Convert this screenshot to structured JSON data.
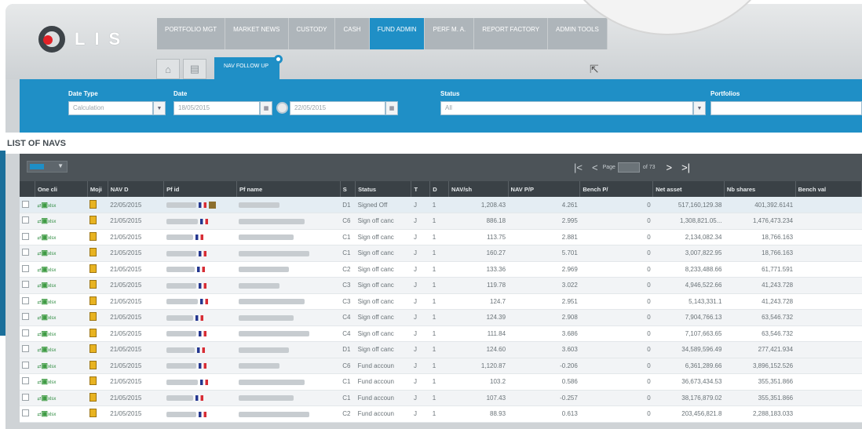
{
  "app": {
    "logo_text": "LIS"
  },
  "top_nav": {
    "tabs": [
      {
        "label": "PORTFOLIO MGT",
        "active": false
      },
      {
        "label": "MARKET NEWS",
        "active": false
      },
      {
        "label": "CUSTODY",
        "active": false
      },
      {
        "label": "CASH",
        "active": false
      },
      {
        "label": "FUND ADMIN",
        "active": true
      },
      {
        "label": "PERF M. A.",
        "active": false
      },
      {
        "label": "REPORT FACTORY",
        "active": false
      },
      {
        "label": "ADMIN TOOLS",
        "active": false
      }
    ]
  },
  "sub_nav": {
    "active_tab": "NAV FOLLOW UP"
  },
  "filters": {
    "date_type": {
      "label": "Date Type",
      "value": "Calculation"
    },
    "date": {
      "label": "Date",
      "from": "18/05/2015",
      "to": "22/05/2015"
    },
    "status": {
      "label": "Status",
      "value": "All"
    },
    "portfolios": {
      "label": "Portfolios",
      "value": ""
    }
  },
  "list": {
    "title": "LIST OF NAVS"
  },
  "pager": {
    "page_label": "Page",
    "page_value": "",
    "of_label": "of 73"
  },
  "columns": [
    "One cli",
    "Moji",
    "NAV D",
    "Pf id",
    "Pf name",
    "S",
    "Status",
    "T",
    "D",
    "NAV/sh",
    "NAV P/P",
    "Bench P/",
    "Net asset",
    "Nb shares",
    "Bench val"
  ],
  "rows": [
    {
      "date": "22/05/2015",
      "cls": "D1",
      "status": "Signed Off",
      "t": "J",
      "d": "1",
      "nav": "1,208.43",
      "navpp": "4.261",
      "bench": "0",
      "net": "517,160,129.38",
      "shares": "401,392.6141",
      "neg": false,
      "stamp": true
    },
    {
      "date": "21/05/2015",
      "cls": "C6",
      "status": "Sign off canc",
      "t": "J",
      "d": "1",
      "nav": "886.18",
      "navpp": "2.995",
      "bench": "0",
      "net": "1,308,821.05...",
      "shares": "1,476,473.234",
      "neg": false,
      "stamp": false
    },
    {
      "date": "21/05/2015",
      "cls": "C1",
      "status": "Sign off canc",
      "t": "J",
      "d": "1",
      "nav": "113.75",
      "navpp": "2.881",
      "bench": "0",
      "net": "2,134,082.34",
      "shares": "18,766.163",
      "neg": false,
      "stamp": false
    },
    {
      "date": "21/05/2015",
      "cls": "C1",
      "status": "Sign off canc",
      "t": "J",
      "d": "1",
      "nav": "160.27",
      "navpp": "5.701",
      "bench": "0",
      "net": "3,007,822.95",
      "shares": "18,766.163",
      "neg": false,
      "stamp": false
    },
    {
      "date": "21/05/2015",
      "cls": "C2",
      "status": "Sign off canc",
      "t": "J",
      "d": "1",
      "nav": "133.36",
      "navpp": "2.969",
      "bench": "0",
      "net": "8,233,488.66",
      "shares": "61,771.591",
      "neg": false,
      "stamp": false
    },
    {
      "date": "21/05/2015",
      "cls": "C3",
      "status": "Sign off canc",
      "t": "J",
      "d": "1",
      "nav": "119.78",
      "navpp": "3.022",
      "bench": "0",
      "net": "4,946,522.66",
      "shares": "41,243.728",
      "neg": false,
      "stamp": false
    },
    {
      "date": "21/05/2015",
      "cls": "C3",
      "status": "Sign off canc",
      "t": "J",
      "d": "1",
      "nav": "124.7",
      "navpp": "2.951",
      "bench": "0",
      "net": "5,143,331.1",
      "shares": "41,243.728",
      "neg": false,
      "stamp": false
    },
    {
      "date": "21/05/2015",
      "cls": "C4",
      "status": "Sign off canc",
      "t": "J",
      "d": "1",
      "nav": "124.39",
      "navpp": "2.908",
      "bench": "0",
      "net": "7,904,766.13",
      "shares": "63,546.732",
      "neg": false,
      "stamp": false
    },
    {
      "date": "21/05/2015",
      "cls": "C4",
      "status": "Sign off canc",
      "t": "J",
      "d": "1",
      "nav": "111.84",
      "navpp": "3.686",
      "bench": "0",
      "net": "7,107,663.65",
      "shares": "63,546.732",
      "neg": false,
      "stamp": false
    },
    {
      "date": "21/05/2015",
      "cls": "D1",
      "status": "Sign off canc",
      "t": "J",
      "d": "1",
      "nav": "124.60",
      "navpp": "3.603",
      "bench": "0",
      "net": "34,589,596.49",
      "shares": "277,421.934",
      "neg": false,
      "stamp": false
    },
    {
      "date": "21/05/2015",
      "cls": "C6",
      "status": "Fund accoun",
      "t": "J",
      "d": "1",
      "nav": "1,120.87",
      "navpp": "-0.206",
      "bench": "0",
      "net": "6,361,289.66",
      "shares": "3,896,152.526",
      "neg": true,
      "stamp": false
    },
    {
      "date": "21/05/2015",
      "cls": "C1",
      "status": "Fund accoun",
      "t": "J",
      "d": "1",
      "nav": "103.2",
      "navpp": "0.586",
      "bench": "0",
      "net": "36,673,434.53",
      "shares": "355,351.866",
      "neg": false,
      "stamp": false
    },
    {
      "date": "21/05/2015",
      "cls": "C1",
      "status": "Fund accoun",
      "t": "J",
      "d": "1",
      "nav": "107.43",
      "navpp": "-0.257",
      "bench": "0",
      "net": "38,176,879.02",
      "shares": "355,351.866",
      "neg": true,
      "stamp": false
    },
    {
      "date": "21/05/2015",
      "cls": "C2",
      "status": "Fund accoun",
      "t": "J",
      "d": "1",
      "nav": "88.93",
      "navpp": "0.613",
      "bench": "0",
      "net": "203,456,821.8",
      "shares": "2,288,183.033",
      "neg": false,
      "stamp": false
    }
  ]
}
